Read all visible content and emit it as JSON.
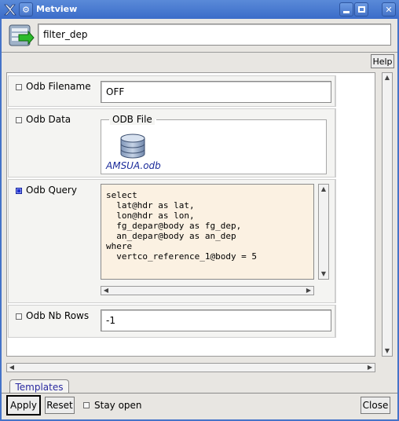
{
  "window": {
    "title": "Metview"
  },
  "header": {
    "title_value": "filter_dep"
  },
  "toolbar": {
    "help_label": "Help"
  },
  "params": {
    "odb_filename": {
      "label": "Odb Filename",
      "value": "OFF",
      "checked": false
    },
    "odb_data": {
      "label": "Odb Data",
      "group_label": "ODB File",
      "file_name": "AMSUA.odb",
      "checked": false
    },
    "odb_query": {
      "label": "Odb Query",
      "checked": true,
      "value": "select\n  lat@hdr as lat,\n  lon@hdr as lon,\n  fg_depar@body as fg_dep,\n  an_depar@body as an_dep\nwhere\n  vertco_reference_1@body = 5"
    },
    "odb_nb_rows": {
      "label": "Odb Nb Rows",
      "value": "-1",
      "checked": false
    }
  },
  "tabs": {
    "templates": "Templates"
  },
  "footer": {
    "apply_label": "Apply",
    "reset_label": "Reset",
    "stay_open_label": "Stay open",
    "close_label": "Close"
  },
  "colors": {
    "titlebar": "#3b6cc9",
    "query_bg": "#fbf1e2",
    "checked_box": "#1e2fd0",
    "file_label": "#1a2a9a"
  }
}
